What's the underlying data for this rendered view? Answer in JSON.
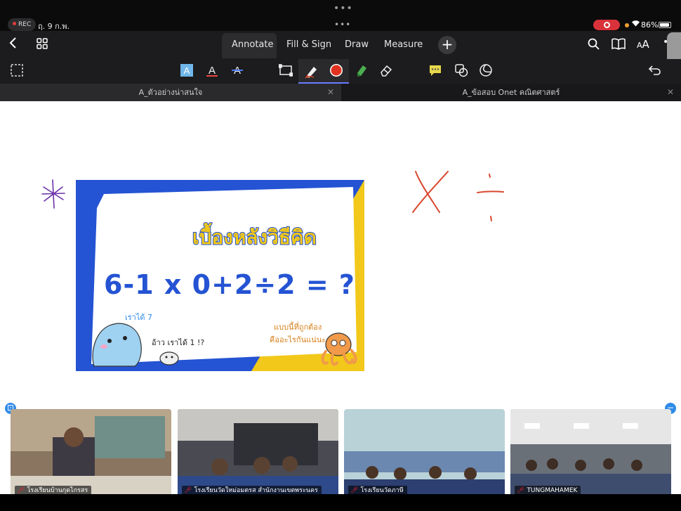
{
  "status": {
    "rec_label": "REC",
    "date": "ฤ. 9 ก.พ.",
    "battery": "86%"
  },
  "nav": {
    "tabs": [
      "Annotate",
      "Fill & Sign",
      "Draw",
      "Measure"
    ],
    "selected_tab": "Annotate",
    "plus": "+"
  },
  "doc_tabs": [
    {
      "title": "A_ตัวอย่างน่าสนใจ",
      "active": true
    },
    {
      "title": "A_ข้อสอบ Onet คณิตศาสตร์",
      "active": false
    }
  ],
  "slide": {
    "title": "เบื้องหลังวิธีคิด",
    "equation": "6-1 x 0+2÷2 = ?",
    "note_left_top": "เราได้ 7",
    "note_left_bottom": "อ้าว เราได้ 1 !?",
    "note_right_1": "แบบนี้ที่ถูกต้อง",
    "note_right_2": "คืออะไรกันแน่นะ"
  },
  "videos": [
    {
      "label": "โรงเรียนบ้านกุดไกรสร"
    },
    {
      "label": "โรงเรียนวัดใหม่อมตรส สำนักงานเขตพระนคร"
    },
    {
      "label": "โรงเรียนวัดภาษี"
    },
    {
      "label": "TUNGMAHAMEK"
    }
  ],
  "colors": {
    "accent": "#6a7cff",
    "ink_red": "#d8472e",
    "ink_purple": "#6b2fa8",
    "slide_blue": "#2453d3",
    "slide_yellow": "#f2c81a"
  }
}
